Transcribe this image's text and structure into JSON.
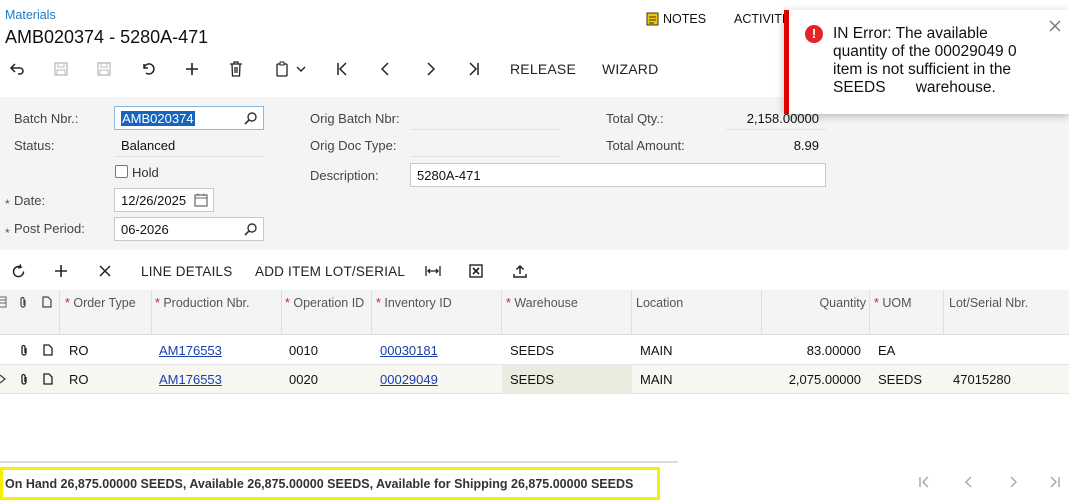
{
  "header": {
    "breadcrumb": "Materials",
    "title": "AMB020374 - 5280A-471",
    "notes_label": "NOTES",
    "activities_label": "ACTIVITI"
  },
  "toolbar": {
    "release_label": "RELEASE",
    "wizard_label": "WIZARD"
  },
  "form": {
    "batch_nbr": {
      "label": "Batch Nbr.:",
      "value": "AMB020374"
    },
    "status": {
      "label": "Status:",
      "value": "Balanced"
    },
    "hold": {
      "label": "Hold",
      "checked": false
    },
    "date": {
      "label": "Date:",
      "value": "12/26/2025"
    },
    "post_period": {
      "label": "Post Period:",
      "value": "06-2026"
    },
    "orig_batch_nbr": {
      "label": "Orig Batch Nbr:",
      "value": ""
    },
    "orig_doc_type": {
      "label": "Orig Doc Type:",
      "value": ""
    },
    "description": {
      "label": "Description:",
      "value": "5280A-471"
    },
    "total_qty": {
      "label": "Total Qty.:",
      "value": "2,158.00000"
    },
    "total_amount": {
      "label": "Total Amount:",
      "value": "8.99"
    }
  },
  "grid_toolbar": {
    "line_details_label": "LINE DETAILS",
    "add_lot_label": "ADD ITEM LOT/SERIAL"
  },
  "grid": {
    "columns": {
      "order_type": "Order Type",
      "production_nbr": "Production Nbr.",
      "operation_id": "Operation ID",
      "inventory_id": "Inventory ID",
      "warehouse": "Warehouse",
      "location": "Location",
      "quantity": "Quantity",
      "uom": "UOM",
      "lot_serial": "Lot/Serial Nbr."
    },
    "rows": [
      {
        "order_type": "RO",
        "production_nbr": "AM176553",
        "operation_id": "0010",
        "inventory_id": "00030181",
        "warehouse": "SEEDS",
        "location": "MAIN",
        "quantity": "83.00000",
        "uom": "EA",
        "lot_serial": ""
      },
      {
        "order_type": "RO",
        "production_nbr": "AM176553",
        "operation_id": "0020",
        "inventory_id": "00029049",
        "warehouse": "SEEDS",
        "location": "MAIN",
        "quantity": "2,075.00000",
        "uom": "SEEDS",
        "lot_serial": "47015280"
      }
    ]
  },
  "status_bar": {
    "text": "On Hand 26,875.00000 SEEDS, Available 26,875.00000 SEEDS, Available for Shipping 26,875.00000 SEEDS"
  },
  "toast": {
    "message": "IN Error: The available quantity of the 00029049 0 item is not sufficient in the SEEDS       warehouse."
  },
  "colors": {
    "accent": "#1f7abf",
    "link": "#1a3fa8",
    "error": "#e00000",
    "highlight": "#f5f000"
  }
}
